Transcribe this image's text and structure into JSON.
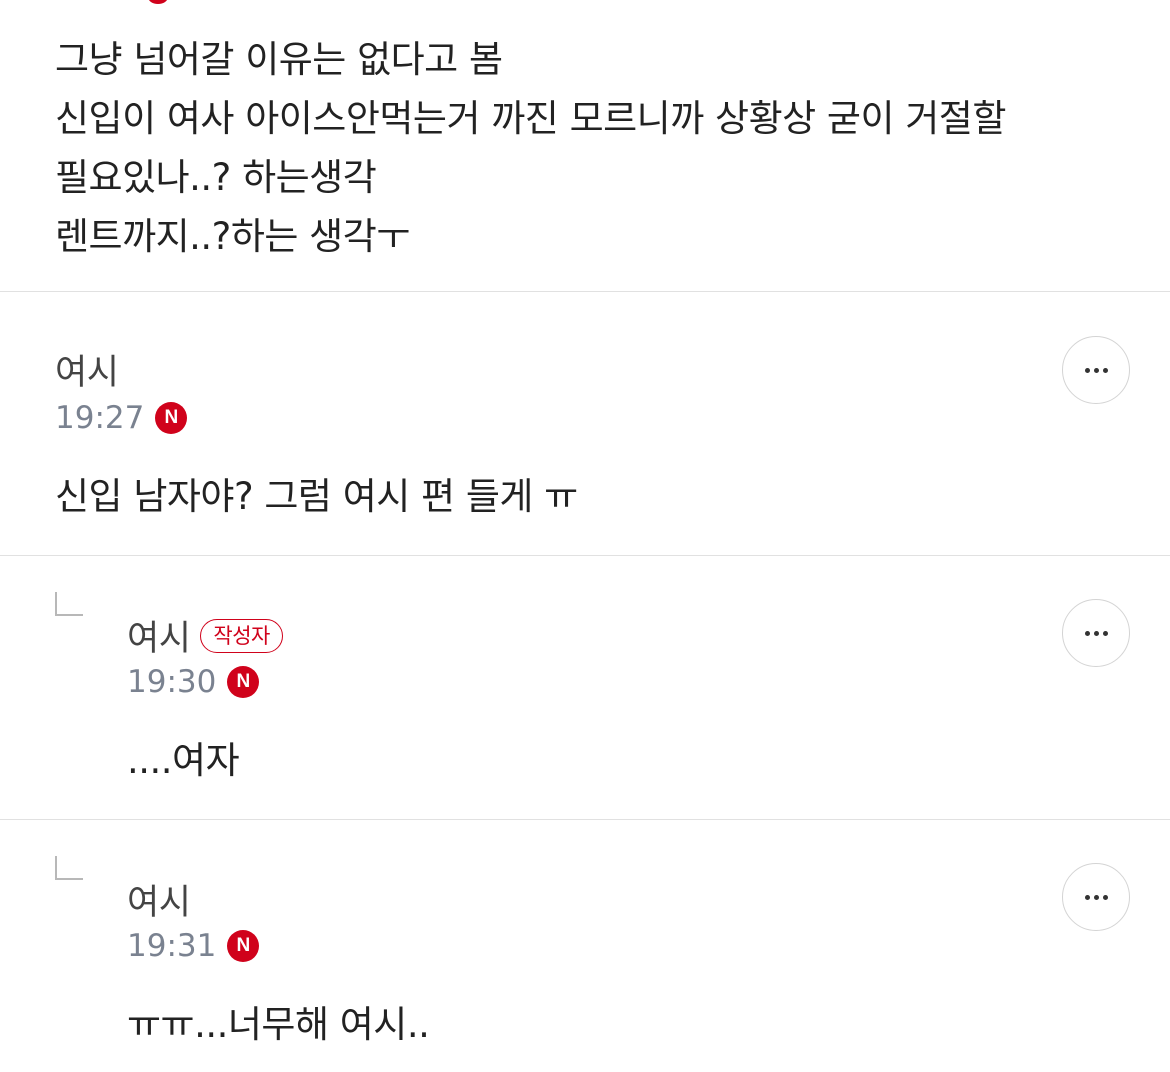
{
  "post": {
    "lines": [
      "그냥 넘어갈 이유는 없다고 봄",
      "신입이 여사 아이스안먹는거 까진 모르니까 상황상 굳이 거절할",
      "필요있나..? 하는생각",
      "렌트까지..?하는 생각ㅜ"
    ]
  },
  "comments": [
    {
      "author": "여시",
      "time": "19:27",
      "new_badge": "N",
      "text": "신입 남자야? 그럼 여시 편 들게 ㅠ"
    },
    {
      "author": "여시",
      "writer_badge": "작성자",
      "time": "19:30",
      "new_badge": "N",
      "text": "....여자"
    },
    {
      "author": "여시",
      "time": "19:31",
      "new_badge": "N",
      "text": "ㅠㅠ...너무해 여시.."
    }
  ],
  "more_icon": "more-horizontal-icon",
  "reply_icon": "reply-corner-icon",
  "colors": {
    "accent_red": "#d0021b",
    "time_gray": "#7a8290",
    "divider": "#e1e1e1",
    "text": "#222222"
  }
}
